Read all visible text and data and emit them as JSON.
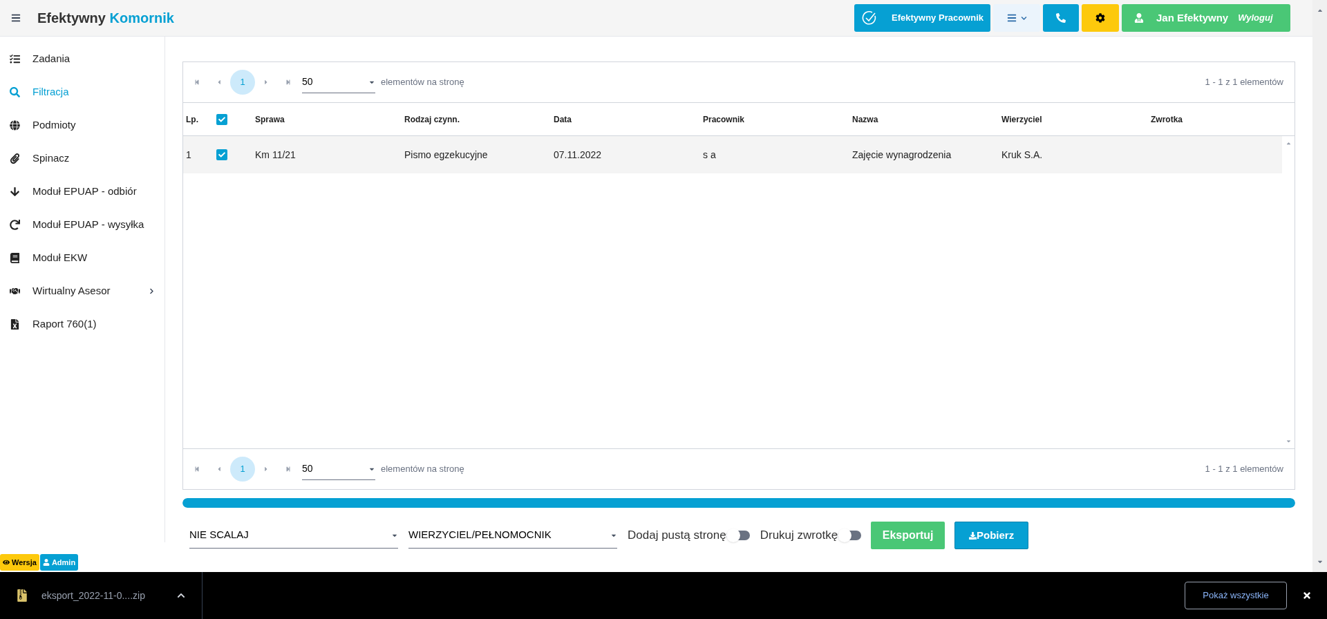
{
  "header": {
    "brand_first": "Efektywny",
    "brand_second": "Komornik",
    "worker_button": "Efektywny Pracownik",
    "user_name": "Jan Efektywny",
    "logout": "Wyloguj"
  },
  "sidebar": {
    "items": [
      {
        "label": "Zadania",
        "selected": false,
        "expandable": false
      },
      {
        "label": "Filtracja",
        "selected": true,
        "expandable": false
      },
      {
        "label": "Podmioty",
        "selected": false,
        "expandable": false
      },
      {
        "label": "Spinacz",
        "selected": false,
        "expandable": false
      },
      {
        "label": "Moduł EPUAP - odbiór",
        "selected": false,
        "expandable": false
      },
      {
        "label": "Moduł EPUAP - wysyłka",
        "selected": false,
        "expandable": false
      },
      {
        "label": "Moduł EKW",
        "selected": false,
        "expandable": false
      },
      {
        "label": "Wirtualny Asesor",
        "selected": false,
        "expandable": true
      },
      {
        "label": "Raport 760(1)",
        "selected": false,
        "expandable": false
      }
    ]
  },
  "pager_top": {
    "page": "1",
    "page_size": "50",
    "per_page_label": "elementów na stronę",
    "summary": "1 - 1 z 1 elementów"
  },
  "table": {
    "columns": [
      "Lp.",
      "",
      "Sprawa",
      "Rodzaj czynn.",
      "Data",
      "Pracownik",
      "Nazwa",
      "Wierzyciel",
      "Zwrotka"
    ],
    "all_checked": true,
    "rows": [
      {
        "checked": true,
        "cells": [
          "1",
          "",
          "Km 11/21",
          "Pismo egzekucyjne",
          "07.11.2022",
          "s a",
          "Zajęcie wynagrodzenia",
          "Kruk S.A.",
          ""
        ]
      }
    ]
  },
  "pager_bottom": {
    "page": "1",
    "page_size": "50",
    "per_page_label": "elementów na stronę",
    "summary": "1 - 1 z 1 elementów"
  },
  "progress": {
    "level": 1
  },
  "controls": {
    "merge_select": "NIE SCALAJ",
    "recipient_select": "WIERZYCIEL/PEŁNOMOCNIK",
    "toggles": [
      {
        "label": "Dodaj pustą stronę",
        "on": false
      },
      {
        "label": "Drukuj zwrotkę",
        "on": false
      }
    ],
    "export_button": "Eksportuj",
    "download_button": "Pobierz"
  },
  "badges": [
    "Wersja",
    "Admin"
  ],
  "download_bar": {
    "file": "eksport_2022-11-0....zip",
    "show_all": "Pokaż wszystkie"
  }
}
